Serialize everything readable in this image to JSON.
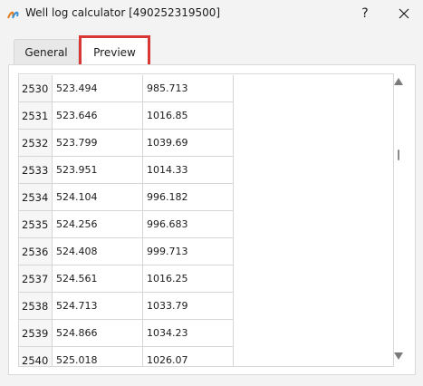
{
  "window": {
    "title": "Well log calculator [490252319500]",
    "help_label": "?",
    "icons": {
      "app": "app-logo-icon",
      "close": "close-icon"
    }
  },
  "tabs": [
    {
      "label": "General",
      "selected": false
    },
    {
      "label": "Preview",
      "selected": true
    }
  ],
  "table": {
    "rows": [
      {
        "index": "2530",
        "depth": "523.494",
        "value": "985.713"
      },
      {
        "index": "2531",
        "depth": "523.646",
        "value": "1016.85"
      },
      {
        "index": "2532",
        "depth": "523.799",
        "value": "1039.69"
      },
      {
        "index": "2533",
        "depth": "523.951",
        "value": "1014.33"
      },
      {
        "index": "2534",
        "depth": "524.104",
        "value": "996.182"
      },
      {
        "index": "2535",
        "depth": "524.256",
        "value": "996.683"
      },
      {
        "index": "2536",
        "depth": "524.408",
        "value": "999.713"
      },
      {
        "index": "2537",
        "depth": "524.561",
        "value": "1016.25"
      },
      {
        "index": "2538",
        "depth": "524.713",
        "value": "1033.79"
      },
      {
        "index": "2539",
        "depth": "524.866",
        "value": "1034.23"
      },
      {
        "index": "2540",
        "depth": "525.018",
        "value": "1026.07"
      }
    ]
  },
  "colors": {
    "tab_highlight": "#d93636",
    "window_bg": "#f3f3f3"
  }
}
